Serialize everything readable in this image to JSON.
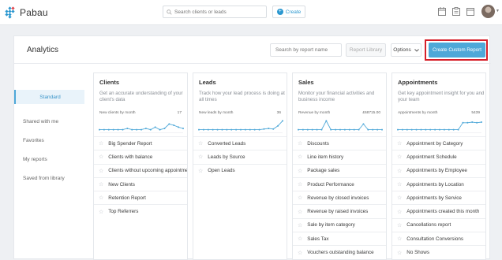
{
  "topbar": {
    "brand": "Pabau",
    "search_placeholder": "Search clients or leads",
    "create_label": "Create",
    "icons": [
      "calendar-icon",
      "clipboard-icon",
      "window-icon"
    ],
    "avatar": "user-avatar"
  },
  "header": {
    "title": "Analytics",
    "search_placeholder": "Search by report name",
    "report_library_label": "Report Library",
    "options_label": "Options",
    "create_custom_label": "Create Custom Report",
    "highlight_color": "#d6202a"
  },
  "sidebar": {
    "items": [
      {
        "label": "Standard",
        "active": true
      },
      {
        "label": "Shared with me"
      },
      {
        "label": "Favorites"
      },
      {
        "label": "My reports"
      },
      {
        "label": "Saved from library"
      }
    ]
  },
  "cards": [
    {
      "title": "Clients",
      "description": "Get an accurate understanding of your client's data",
      "metric_label": "New clients by month",
      "metric_value": "17",
      "spark": [
        0.15,
        0.15,
        0.15,
        0.15,
        0.15,
        0.15,
        0.25,
        0.15,
        0.15,
        0.15,
        0.25,
        0.15,
        0.35,
        0.15,
        0.25,
        0.6,
        0.5,
        0.35,
        0.25
      ],
      "reports": [
        "Big Spender Report",
        "Clients with balance",
        "Clients without upcoming appointments",
        "New Clients",
        "Retention Report",
        "Top Referrers"
      ]
    },
    {
      "title": "Leads",
      "description": "Track how your lead process is doing at all times",
      "metric_label": "New leads by month",
      "metric_value": "36",
      "spark": [
        0.15,
        0.15,
        0.15,
        0.15,
        0.15,
        0.15,
        0.15,
        0.15,
        0.15,
        0.15,
        0.15,
        0.15,
        0.15,
        0.15,
        0.2,
        0.25,
        0.2,
        0.45,
        0.85
      ],
      "reports": [
        "Converted Leads",
        "Leads by Source",
        "Open Leads"
      ]
    },
    {
      "title": "Sales",
      "description": "Monitor your financial activities and business income",
      "metric_label": "Revenue by month",
      "metric_value": "£68715.00",
      "spark": [
        0.15,
        0.15,
        0.15,
        0.15,
        0.15,
        0.15,
        0.85,
        0.15,
        0.15,
        0.15,
        0.15,
        0.15,
        0.15,
        0.15,
        0.6,
        0.15,
        0.15,
        0.15,
        0.15
      ],
      "reports": [
        "Discounts",
        "Line item history",
        "Package sales",
        "Product Performance",
        "Revenue by closed invoices",
        "Revenue by raised invoices",
        "Sale by item category",
        "Sales Tax",
        "Vouchers outstanding balance"
      ]
    },
    {
      "title": "Appointments",
      "description": "Get key appointment insight for you and your team",
      "metric_label": "Appointments by month",
      "metric_value": "5439",
      "spark": [
        0.15,
        0.15,
        0.15,
        0.15,
        0.15,
        0.15,
        0.15,
        0.15,
        0.15,
        0.15,
        0.15,
        0.15,
        0.15,
        0.15,
        0.7,
        0.7,
        0.75,
        0.7,
        0.75
      ],
      "reports": [
        "Appointment by Category",
        "Appointment Schedule",
        "Appointments by Employee",
        "Appointments by Location",
        "Appointments by Service",
        "Appointments created this month",
        "Cancellations report",
        "Consultation Conversions",
        "No Shows"
      ]
    }
  ],
  "colors": {
    "accent": "#4ea8d8",
    "link": "#2a97d0",
    "spark": "#4ea8d8"
  }
}
